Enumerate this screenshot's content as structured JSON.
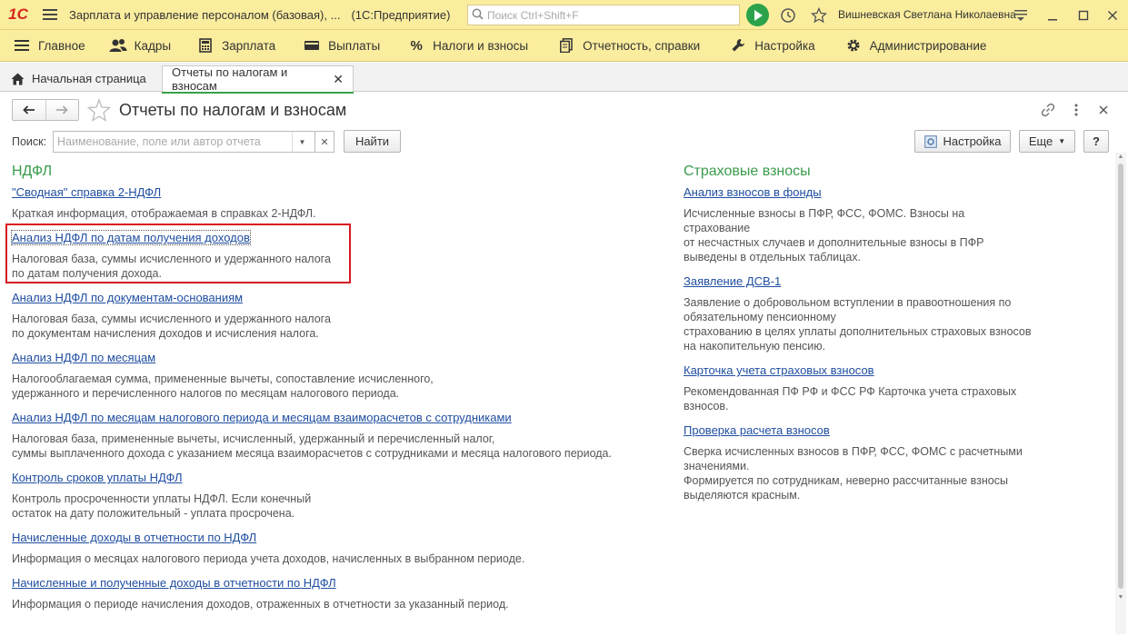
{
  "titlebar": {
    "logo": "1С",
    "app_title": "Зарплата и управление персоналом (базовая), ...",
    "platform": "(1С:Предприятие)",
    "search_placeholder": "Поиск Ctrl+Shift+F",
    "user": "Вишневская Светлана Николаевна"
  },
  "mainmenu": {
    "items": [
      {
        "label": "Главное",
        "icon": "hamburger-icon"
      },
      {
        "label": "Кадры",
        "icon": "people-icon"
      },
      {
        "label": "Зарплата",
        "icon": "calculator-icon"
      },
      {
        "label": "Выплаты",
        "icon": "wallet-icon"
      },
      {
        "label": "Налоги и взносы",
        "icon": "percent-icon"
      },
      {
        "label": "Отчетность, справки",
        "icon": "documents-icon"
      },
      {
        "label": "Настройка",
        "icon": "wrench-icon"
      },
      {
        "label": "Администрирование",
        "icon": "gear-icon"
      }
    ]
  },
  "tabs": {
    "home": "Начальная страница",
    "active": "Отчеты по налогам и взносам"
  },
  "form": {
    "title": "Отчеты по налогам и взносам",
    "search_label": "Поиск:",
    "search_placeholder": "Наименование, поле или автор отчета",
    "find_button": "Найти",
    "settings_button": "Настройка",
    "more_button": "Еще",
    "help_button": "?"
  },
  "left": {
    "heading": "НДФЛ",
    "reports": [
      {
        "title": "\"Сводная\" справка 2-НДФЛ",
        "desc": [
          "Краткая информация, отображаемая в справках 2-НДФЛ."
        ]
      },
      {
        "title": "Анализ НДФЛ по датам получения доходов",
        "desc": [
          "Налоговая база, суммы исчисленного и удержанного налога",
          "по датам получения дохода."
        ]
      },
      {
        "title": "Анализ НДФЛ по документам-основаниям",
        "desc": [
          "Налоговая база, суммы исчисленного и удержанного налога",
          "по документам начисления доходов и исчисления налога."
        ]
      },
      {
        "title": "Анализ НДФЛ по месяцам",
        "desc": [
          "Налогооблагаемая сумма, примененные вычеты, сопоставление исчисленного,",
          "удержанного и перечисленного налогов по месяцам налогового периода."
        ]
      },
      {
        "title": "Анализ НДФЛ по месяцам налогового периода и месяцам взаиморасчетов с сотрудниками",
        "desc": [
          "Налоговая база, примененные вычеты, исчисленный, удержанный и перечисленный налог,",
          "суммы выплаченного дохода с указанием месяца взаиморасчетов с сотрудниками и месяца налогового периода."
        ]
      },
      {
        "title": "Контроль сроков уплаты НДФЛ",
        "desc": [
          "Контроль просроченности уплаты НДФЛ. Если конечный",
          "остаток на дату положительный - уплата просрочена."
        ]
      },
      {
        "title": "Начисленные доходы в отчетности по НДФЛ",
        "desc": [
          "Информация о месяцах налогового периода учета доходов, начисленных в выбранном периоде."
        ]
      },
      {
        "title": "Начисленные и полученные доходы в отчетности по НДФЛ",
        "desc": [
          "Информация о периоде начисления доходов, отраженных в отчетности за указанный период."
        ]
      }
    ]
  },
  "right": {
    "heading": "Страховые взносы",
    "reports": [
      {
        "title": "Анализ взносов в фонды",
        "desc": [
          "Исчисленные взносы в ПФР, ФСС, ФОМС. Взносы на",
          "страхование",
          "от несчастных случаев и дополнительные взносы в ПФР",
          "выведены в отдельных таблицах."
        ]
      },
      {
        "title": "Заявление ДСВ-1",
        "desc": [
          "Заявление о добровольном вступлении в правоотношения по",
          "обязательному пенсионному",
          "страхованию в целях уплаты дополнительных страховых взносов",
          "на накопительную пенсию."
        ]
      },
      {
        "title": "Карточка учета страховых взносов",
        "desc": [
          "Рекомендованная ПФ РФ и ФСС РФ Карточка учета страховых",
          "взносов."
        ]
      },
      {
        "title": "Проверка расчета взносов",
        "desc": [
          "Сверка исчисленных взносов в ПФР, ФСС, ФОМС с расчетными",
          "значениями.",
          "Формируется по сотрудникам, неверно рассчитанные взносы",
          "выделяются красным."
        ]
      }
    ]
  },
  "colors": {
    "accent_yellow": "#fbed9e",
    "section_green": "#3a9b4b",
    "link_blue": "#1f4ea0",
    "highlight_red": "#d71920"
  }
}
